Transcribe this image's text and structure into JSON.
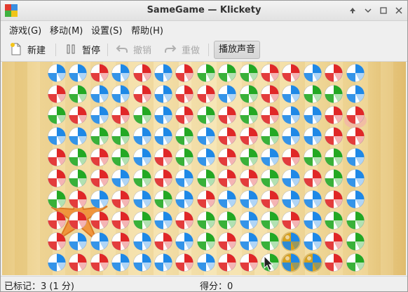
{
  "window": {
    "title": "SameGame — Klickety"
  },
  "menu": [
    "游戏(G)",
    "移动(M)",
    "设置(S)",
    "帮助(H)"
  ],
  "toolbar": {
    "new_label": "新建",
    "pause_label": "暂停",
    "undo_label": "撤销",
    "redo_label": "重做",
    "sound_label": "播放声音"
  },
  "status": {
    "marked": "已标记：3 (1 分)",
    "score": "得分：0"
  },
  "colors": {
    "red": "#e02727",
    "blue": "#1e88e6",
    "green": "#23a823",
    "highlight": "#d7a11d"
  },
  "board": {
    "columns": 15,
    "rows": 10,
    "grid": [
      "BBRBRBRGGGRRBRB",
      "RGBBRBRRBGRBGGB",
      "GRBRGBRGRGRBBRR",
      "BBGGBBGBRRGBBRR",
      "RGRGBRGBRGBRGGB",
      "RGRBGRBGRRGBRGB",
      "GRBRBGBRBBRBBRB",
      "RRRRGBRGGBGRBGG",
      "RBBRBRBGRBGBBRG",
      "BRRBBBRBRRGBBRG"
    ],
    "highlighted": [
      [
        8,
        11
      ],
      [
        9,
        11
      ],
      [
        9,
        12
      ]
    ]
  }
}
